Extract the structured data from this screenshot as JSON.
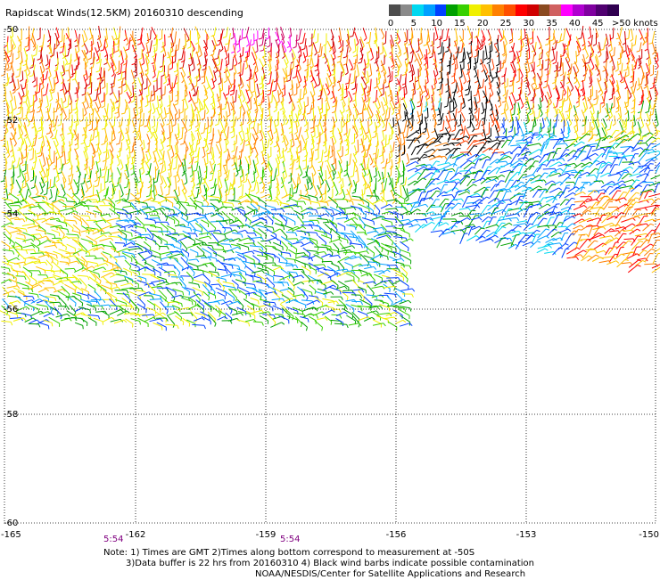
{
  "title": "Rapidscat Winds(12.5KM) 20160310 descending",
  "legend": {
    "colors": [
      "#4d4d4d",
      "#8a8a8a",
      "#00d8f0",
      "#00a0ff",
      "#0040ff",
      "#00a000",
      "#38d000",
      "#f0f000",
      "#ffc000",
      "#ff8000",
      "#ff5000",
      "#ff0000",
      "#d00000",
      "#8a4a20",
      "#d06060",
      "#ff00ff",
      "#b000d0",
      "#8000a0",
      "#500070",
      "#300050"
    ],
    "labels": [
      "0",
      "5",
      "10",
      "15",
      "20",
      "25",
      "30",
      "35",
      "40",
      "45"
    ],
    "last_label": ">50 knots"
  },
  "axes": {
    "x_ticks": [
      "-165",
      "-162",
      "-159",
      "-156",
      "-153",
      "-150"
    ],
    "y_ticks": [
      "-50",
      "-52",
      "-54",
      "-56",
      "-58",
      "-60"
    ]
  },
  "times": [
    "5:54",
    "5:54"
  ],
  "notes": {
    "line1": "Note: 1) Times are GMT 2)Times along bottom correspond to measurement at -50S",
    "line2": "3)Data buffer is 22 hrs from 20160310 4) Black wind barbs indicate possible contamination",
    "credit": "NOAA/NESDIS/Center for Satellite Applications and Research"
  }
}
